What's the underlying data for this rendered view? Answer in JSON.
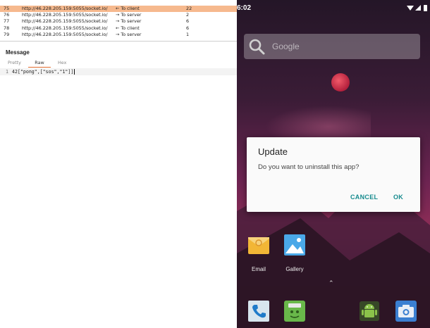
{
  "websocket_history": {
    "rows": [
      {
        "num": "75",
        "url": "http://46.228.205.159:5055/socket.io/",
        "direction": "← To client",
        "length": "22",
        "selected": true
      },
      {
        "num": "76",
        "url": "http://46.228.205.159:5055/socket.io/",
        "direction": "→ To server",
        "length": "2",
        "selected": false
      },
      {
        "num": "77",
        "url": "http://46.228.205.159:5055/socket.io/",
        "direction": "→ To server",
        "length": "6",
        "selected": false
      },
      {
        "num": "78",
        "url": "http://46.228.205.159:5055/socket.io/",
        "direction": "← To client",
        "length": "6",
        "selected": false
      },
      {
        "num": "79",
        "url": "http://46.228.205.159:5055/socket.io/",
        "direction": "→ To server",
        "length": "1",
        "selected": false
      }
    ]
  },
  "message": {
    "title": "Message",
    "tabs": [
      {
        "label": "Pretty",
        "active": false
      },
      {
        "label": "Raw",
        "active": true
      },
      {
        "label": "Hex",
        "active": false
      }
    ],
    "line_number": "1",
    "content": "42[\"pong\",[\"sos\",\"1\"]]"
  },
  "android": {
    "clock": "6:02",
    "search_placeholder": "Google",
    "dialog": {
      "title": "Update",
      "message": "Do you want to uninstall this app?",
      "cancel_label": "CANCEL",
      "ok_label": "OK"
    },
    "apps": [
      {
        "label": "Email",
        "icon": "email-icon"
      },
      {
        "label": "Gallery",
        "icon": "gallery-icon"
      }
    ],
    "dock": [
      "phone-icon",
      "messenger-icon",
      "android-icon",
      "camera-icon"
    ],
    "accent_color": "#168b8e"
  }
}
